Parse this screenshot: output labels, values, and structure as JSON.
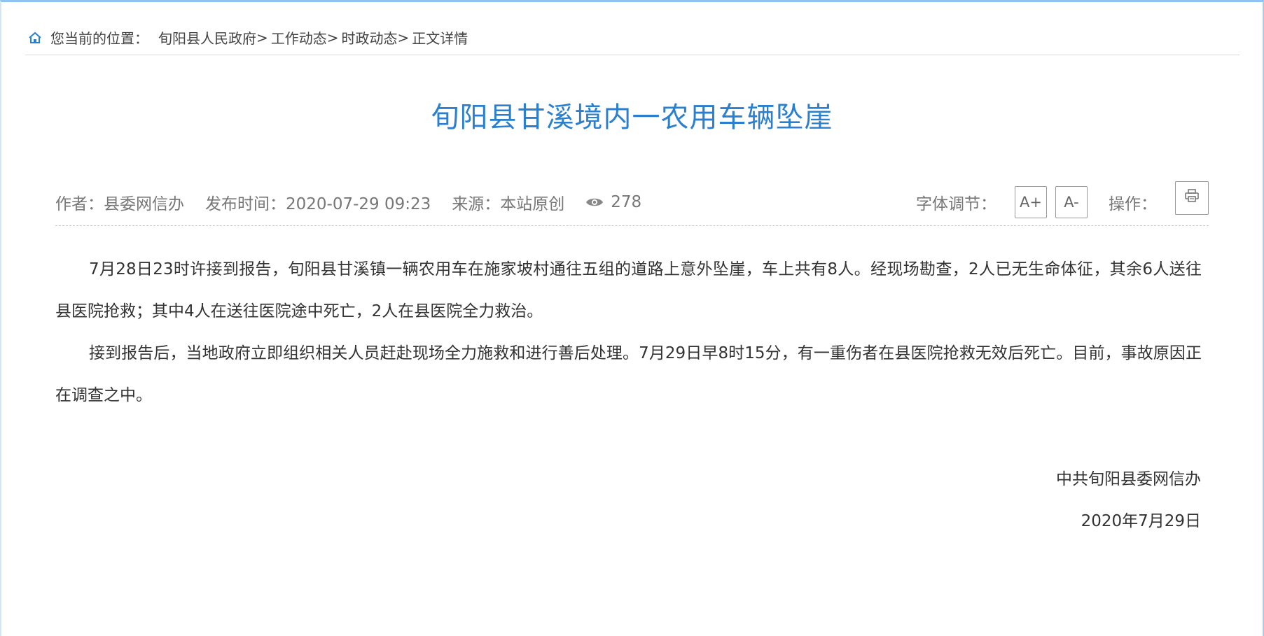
{
  "breadcrumb": {
    "label": "您当前的位置：",
    "items": [
      {
        "text": "旬阳县人民政府"
      },
      {
        "text": "工作动态"
      },
      {
        "text": "时政动态"
      },
      {
        "text": "正文详情"
      }
    ],
    "separator": ">"
  },
  "article": {
    "title": "旬阳县甘溪境内一农用车辆坠崖",
    "meta": {
      "author": "作者：县委网信办",
      "published": "发布时间：2020-07-29 09:23",
      "source": "来源：本站原创",
      "views": "278"
    },
    "controls": {
      "font_label": "字体调节：",
      "font_increase": "A+",
      "font_decrease": "A-",
      "operation_label": "操作："
    },
    "paragraphs": [
      "7月28日23时许接到报告，旬阳县甘溪镇一辆农用车在施家坡村通往五组的道路上意外坠崖，车上共有8人。经现场勘查，2人已无生命体征，其余6人送往县医院抢救；其中4人在送往医院途中死亡，2人在县医院全力救治。",
      "接到报告后，当地政府立即组织相关人员赶赴现场全力施救和进行善后处理。7月29日早8时15分，有一重伤者在县医院抢救无效后死亡。目前，事故原因正在调查之中。"
    ],
    "signature": {
      "org": "中共旬阳县委网信办",
      "date": "2020年7月29日"
    }
  },
  "colors": {
    "title": "#2a7fcf",
    "home_icon": "#2a7fcf",
    "frame_border": "#8fc3f2"
  },
  "icons": {
    "home": "home-icon",
    "views": "eye-icon",
    "print": "printer-icon"
  }
}
